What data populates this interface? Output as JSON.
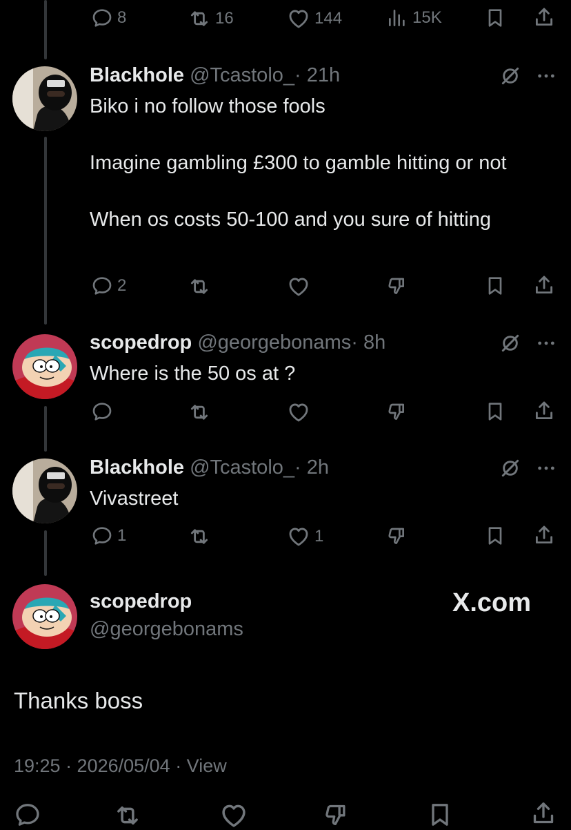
{
  "top_bar": {
    "replies": "8",
    "reposts": "16",
    "likes": "144",
    "views": "15K"
  },
  "replies": [
    {
      "name": "Blackhole",
      "handle": "@Tcastolo_",
      "time": "· 21h",
      "text": "Biko i no follow those fools\n\nImagine gambling £300 to gamble hitting or not\n\nWhen os costs 50-100 and you sure of hitting",
      "reply_count": "2",
      "like_count": ""
    },
    {
      "name": "scopedrop",
      "handle": "@georgebonams",
      "time": "· 8h",
      "text": "Where is the 50 os at ?",
      "reply_count": "",
      "like_count": ""
    },
    {
      "name": "Blackhole",
      "handle": "@Tcastolo_",
      "time": "· 2h",
      "text": "Vivastreet",
      "reply_count": "1",
      "like_count": "1"
    }
  ],
  "main_post": {
    "name": "scopedrop",
    "handle": "@georgebonams",
    "watermark": "X.com",
    "text": "Thanks boss",
    "meta": "19:25 · 2026/05/04 · View"
  },
  "icons": {
    "reply": "reply-icon",
    "repost": "repost-icon",
    "like": "heart-icon",
    "views": "views-icon",
    "bookmark": "bookmark-icon",
    "share": "share-icon",
    "downvote": "downvote-icon",
    "grok": "grok-icon",
    "more": "more-icon"
  },
  "colors": {
    "background": "#000000",
    "text": "#e7e9ea",
    "secondary": "#71767b",
    "thread_line": "#333639"
  }
}
